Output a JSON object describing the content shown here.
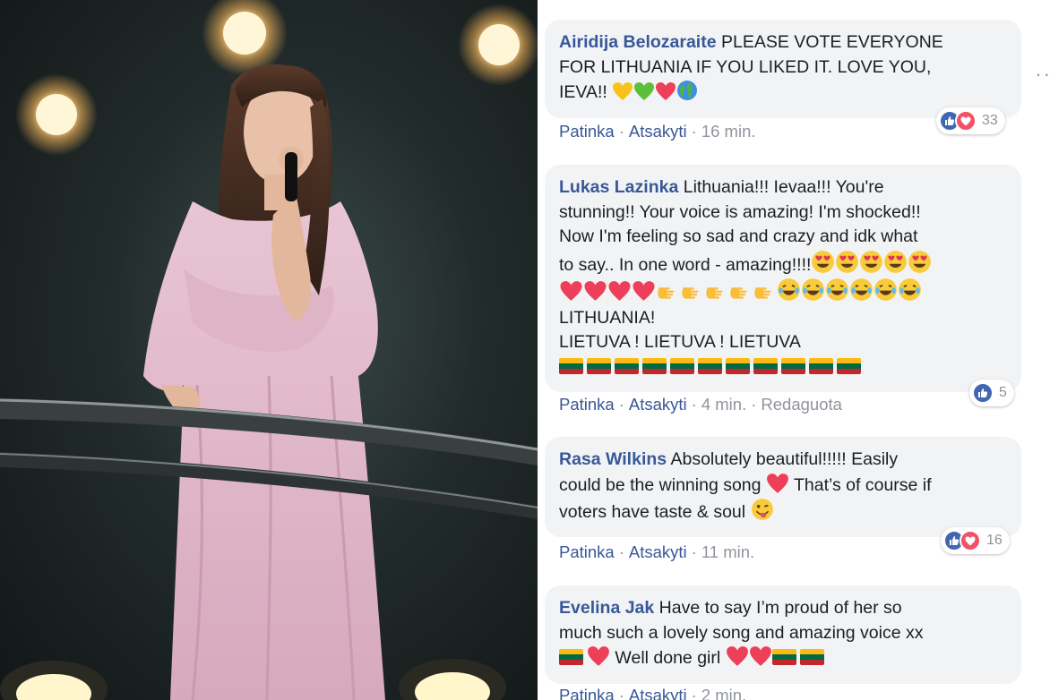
{
  "comments": [
    {
      "author": "Airidija Belozaraite",
      "line1": "PLEASE VOTE EVERYONE",
      "line2": "FOR LITHUANIA IF YOU LIKED IT. LOVE YOU,",
      "line3": "IEVA!!",
      "like_label": "Patinka",
      "reply_label": "Atsakyti",
      "time": "16 min.",
      "reaction_count": "33"
    },
    {
      "author": "Lukas Lazinka",
      "line1": "Lithuania!!! Ievaa!!! You're",
      "line2": "stunning!! Your voice is amazing! I'm shocked!!",
      "line3": "Now I'm feeling so sad and crazy and idk what",
      "line4": "to say.. In one word - amazing!!!!",
      "line6": "LITHUANIA!",
      "line7": "LIETUVA ! LIETUVA ! LIETUVA",
      "like_label": "Patinka",
      "reply_label": "Atsakyti",
      "time": "4 min.",
      "edited": "Redaguota",
      "reaction_count": "5"
    },
    {
      "author": "Rasa Wilkins",
      "line1": "Absolutely beautiful!!!!! Easily",
      "line2a": "could be the winning song",
      "line2b": "That’s of course if",
      "line3": "voters have taste & soul",
      "like_label": "Patinka",
      "reply_label": "Atsakyti",
      "time": "11 min.",
      "reaction_count": "16"
    },
    {
      "author": "Evelina Jak",
      "line1": "Have to say I’m proud of her so",
      "line2": "much such a lovely song and amazing voice xx",
      "line3": "Well done girl",
      "like_label": "Patinka",
      "reply_label": "Atsakyti",
      "time": "2 min."
    }
  ],
  "colors": {
    "author": "#385898",
    "bubble": "#f2f3f5",
    "meta": "#90949c",
    "like": "#4267b2",
    "love": "#f25268"
  },
  "icons": [
    "like-icon",
    "love-icon",
    "heart-emoji",
    "laugh-emoji",
    "heart-eyes-emoji",
    "pointing-hand-emoji",
    "lithuania-flag",
    "globe-emoji",
    "more-options-icon"
  ]
}
